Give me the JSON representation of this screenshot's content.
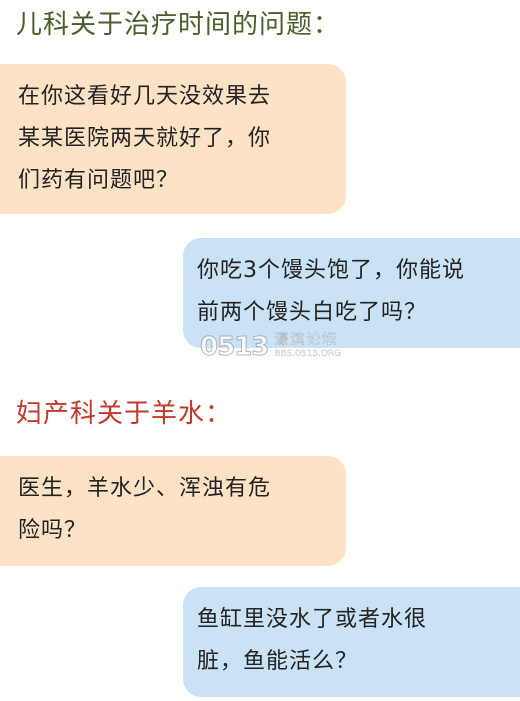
{
  "sections": [
    {
      "heading": "儿科关于治疗时间的问题：",
      "question_lines": [
        "在你这看好几天没效果去",
        "某某医院两天就好了，你",
        "们药有问题吧？"
      ],
      "answer_lines": [
        "你吃3个馒头饱了，你能说",
        "前两个馒头白吃了吗？"
      ]
    },
    {
      "heading": "妇产科关于羊水：",
      "question_lines": [
        "医生，羊水少、浑浊有危",
        "险吗？"
      ],
      "answer_lines": [
        "鱼缸里没水了或者水很",
        "脏，鱼能活么？"
      ]
    }
  ],
  "watermark": {
    "logo": "0513",
    "title": "濠滨论坛",
    "url": "BBS.0513.ORG"
  },
  "colors": {
    "heading_1": "#4a5d2a",
    "heading_2": "#c0392b",
    "question_bubble": "#fde2c6",
    "answer_bubble": "#c9e2f6"
  }
}
